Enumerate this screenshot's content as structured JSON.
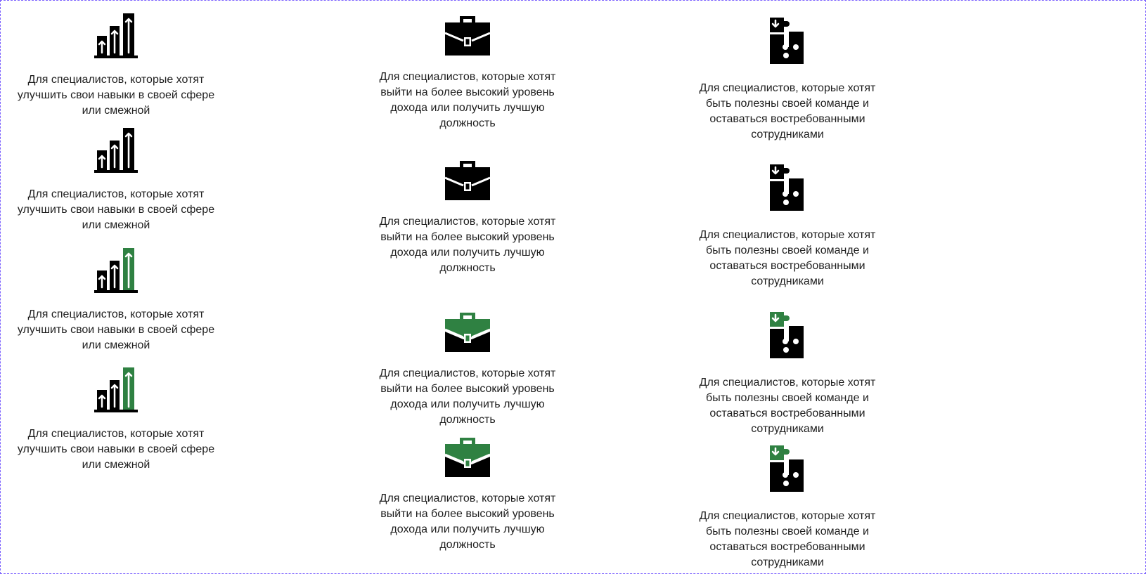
{
  "colors": {
    "black": "#000000",
    "green": "#2f8142"
  },
  "columns": [
    {
      "name": "growth",
      "icon": "bar-chart-arrows-icon",
      "text": "Для специалистов, которые хотят\nулучшить свои навыки в своей сфере\nили смежной",
      "variants": [
        "default",
        "default",
        "highlighted",
        "highlighted"
      ]
    },
    {
      "name": "career",
      "icon": "briefcase-icon",
      "text": "Для специалистов, которые хотят\nвыйти на более высокий уровень\nдохода или получить лучшую\nдолжность",
      "variants": [
        "default",
        "default",
        "highlighted",
        "highlighted"
      ]
    },
    {
      "name": "team",
      "icon": "puzzle-icon",
      "text": "Для специалистов, которые хотят\nбыть полезны своей команде и\nоставаться востребованными\nсотрудниками",
      "variants": [
        "default",
        "default",
        "highlighted",
        "highlighted"
      ]
    }
  ]
}
